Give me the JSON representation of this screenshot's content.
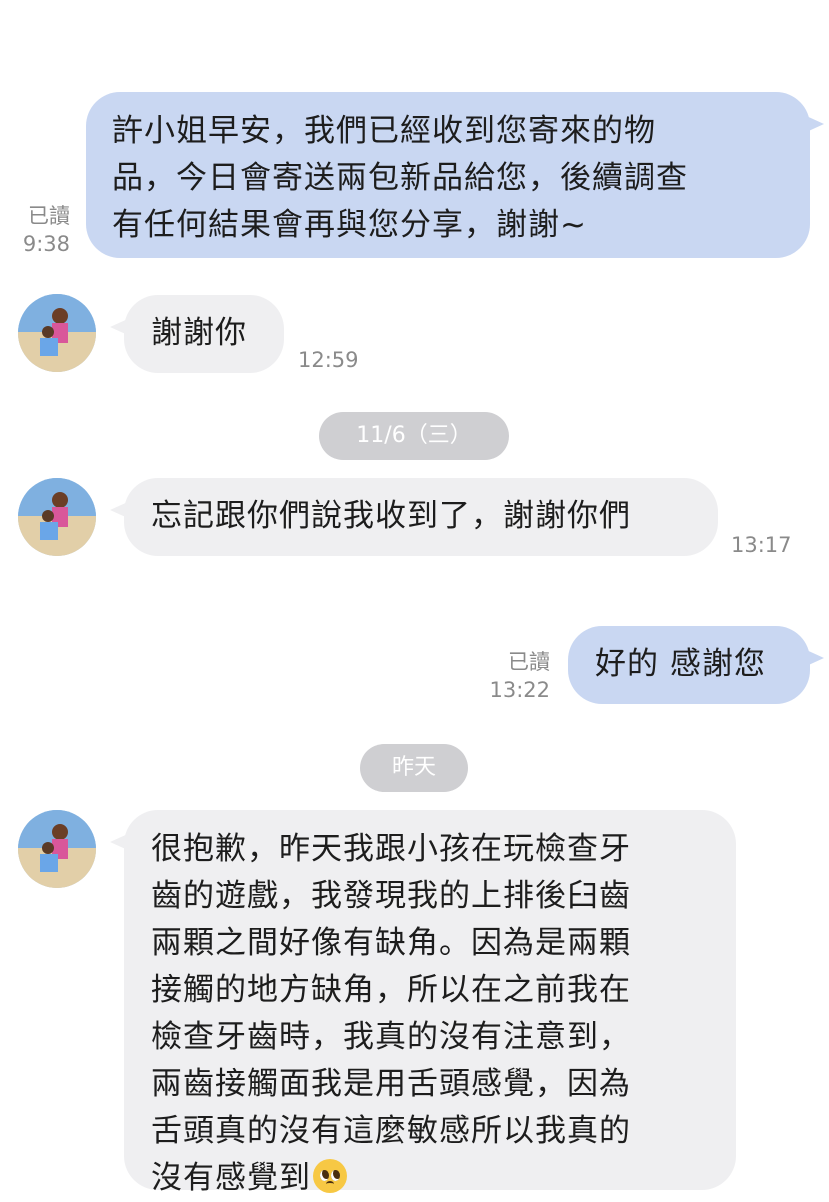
{
  "messages": {
    "m1": {
      "lines": [
        "許小姐早安，我們已經收到您寄來的物",
        "品，今日會寄送兩包新品給您，後續調查",
        "有任何結果會再與您分享，謝謝~"
      ],
      "read": "已讀",
      "time": "9:38"
    },
    "m2": {
      "text": "謝謝你",
      "time": "12:59"
    },
    "date1": "11/6（三）",
    "m3": {
      "text": "忘記跟你們說我收到了，謝謝你們",
      "time": "13:17"
    },
    "m4": {
      "text": "好的 感謝您",
      "read": "已讀",
      "time": "13:22"
    },
    "date2": "昨天",
    "m5": {
      "lines": [
        "很抱歉，昨天我跟小孩在玩檢查牙",
        "齒的遊戲，我發現我的上排後臼齒",
        "兩顆之間好像有缺角。因為是兩顆",
        "接觸的地方缺角，所以在之前我在",
        "檢查牙齒時，我真的沒有注意到，",
        "兩齒接觸面我是用舌頭感覺，因為",
        "舌頭真的沒有這麼敏感所以我真的",
        "沒有感覺到"
      ],
      "emoji": "pleading-face-emoji"
    }
  },
  "colors": {
    "outgoing_bubble": "#c9d7f2",
    "incoming_bubble": "#efeff1",
    "meta_text": "#8a8a8a",
    "date_pill": "#cfcfd2"
  }
}
